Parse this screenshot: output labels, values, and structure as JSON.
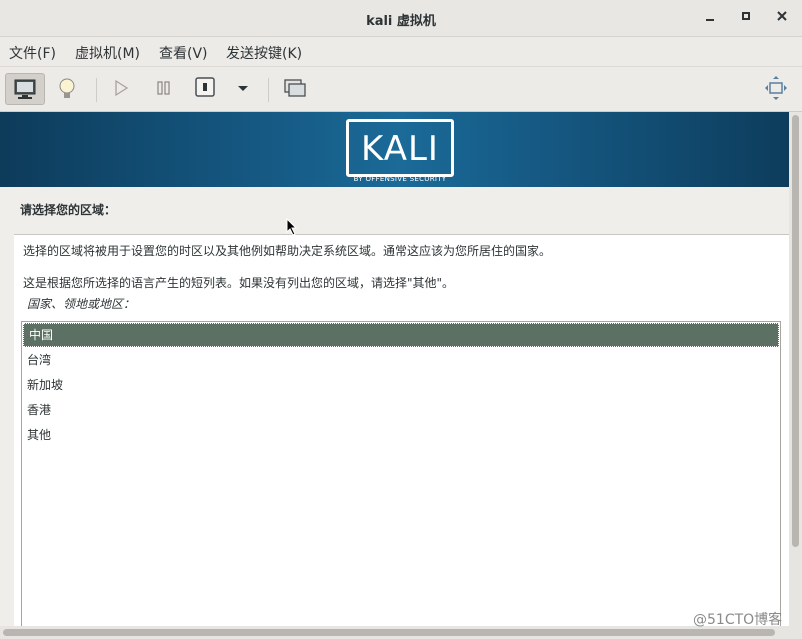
{
  "window": {
    "title": "kali 虚拟机"
  },
  "menu": [
    "文件(F)",
    "虚拟机(M)",
    "查看(V)",
    "发送按键(K)"
  ],
  "toolbar": {
    "icons": [
      "monitor-icon",
      "bulb-icon",
      "play-icon",
      "pause-icon",
      "stop-icon",
      "dropdown-icon",
      "snapshot-icon",
      "fullscreen-icon"
    ]
  },
  "banner": {
    "logo": "KALI",
    "subtitle": "BY OFFENSIVE SECURITY"
  },
  "installer": {
    "prompt": "请选择您的区域：",
    "description1": "选择的区域将被用于设置您的时区以及其他例如帮助决定系统区域。通常这应该为您所居住的国家。",
    "description2": "这是根据您所选择的语言产生的短列表。如果没有列出您的区域，请选择\"其他\"。",
    "list_label": "国家、领地或地区：",
    "options": [
      "中国",
      "台湾",
      "新加坡",
      "香港",
      "其他"
    ],
    "selected": "中国"
  },
  "watermark": "@51CTO博客",
  "colors": {
    "banner": "#165b86",
    "selection": "#5c7063"
  }
}
